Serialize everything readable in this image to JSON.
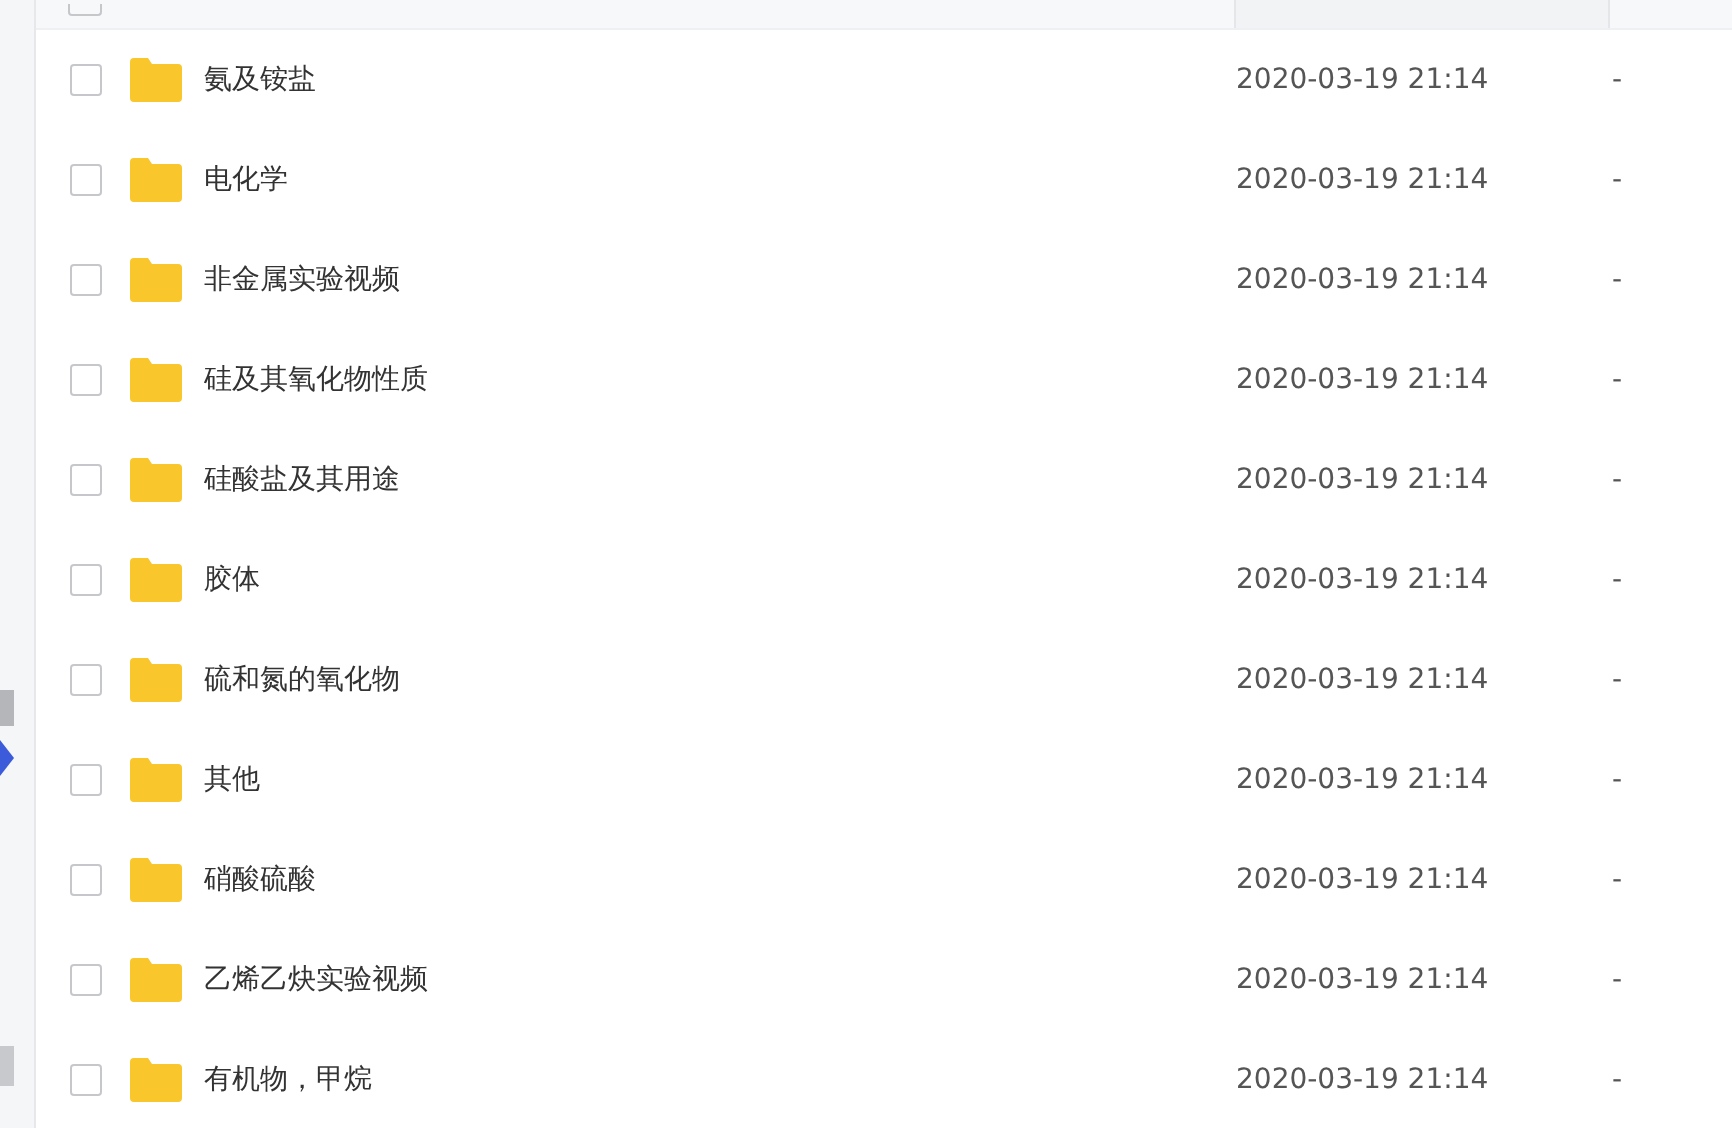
{
  "file_list": {
    "header": {
      "select_all": false
    },
    "rows": [
      {
        "name": "氨及铵盐",
        "modified": "2020-03-19 21:14",
        "size": "-",
        "selected": false
      },
      {
        "name": "电化学",
        "modified": "2020-03-19 21:14",
        "size": "-",
        "selected": false
      },
      {
        "name": "非金属实验视频",
        "modified": "2020-03-19 21:14",
        "size": "-",
        "selected": false
      },
      {
        "name": "硅及其氧化物性质",
        "modified": "2020-03-19 21:14",
        "size": "-",
        "selected": false
      },
      {
        "name": "硅酸盐及其用途",
        "modified": "2020-03-19 21:14",
        "size": "-",
        "selected": false
      },
      {
        "name": "胶体",
        "modified": "2020-03-19 21:14",
        "size": "-",
        "selected": false
      },
      {
        "name": "硫和氮的氧化物",
        "modified": "2020-03-19 21:14",
        "size": "-",
        "selected": false
      },
      {
        "name": "其他",
        "modified": "2020-03-19 21:14",
        "size": "-",
        "selected": false
      },
      {
        "name": "硝酸硫酸",
        "modified": "2020-03-19 21:14",
        "size": "-",
        "selected": false
      },
      {
        "name": "乙烯乙炔实验视频",
        "modified": "2020-03-19 21:14",
        "size": "-",
        "selected": false
      },
      {
        "name": "有机物，甲烷",
        "modified": "2020-03-19 21:14",
        "size": "-",
        "selected": false
      }
    ]
  }
}
